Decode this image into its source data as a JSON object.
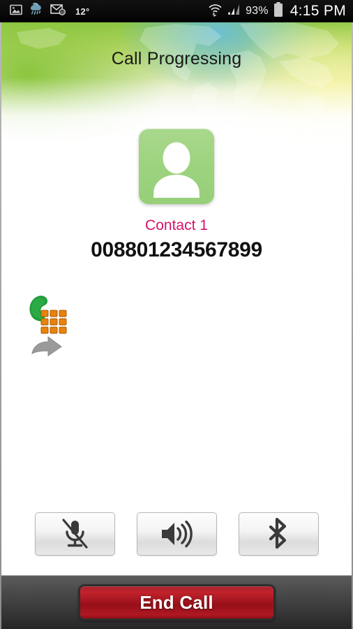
{
  "status_bar": {
    "icons_left": [
      "image-icon",
      "weather-rain-icon",
      "email-icon"
    ],
    "temperature": "12°",
    "wifi_icon": "wifi-icon",
    "signal_icon": "cellular-signal-icon",
    "battery_percent": "93%",
    "battery_icon": "battery-icon",
    "clock": "4:15 PM"
  },
  "header": {
    "call_state": "Call Progressing",
    "background_colors": {
      "green": "#8cc63f",
      "teal": "#6abed7",
      "yellow": "#f7f4a0",
      "white": "#ffffff"
    }
  },
  "contact": {
    "avatar_icon": "person-avatar-icon",
    "avatar_color": "#9dd37f",
    "name": "Contact 1",
    "name_color": "#d5136a",
    "number": "008801234567899"
  },
  "call_action": {
    "icon": "dialpad-phone-forward-icon",
    "handset_color": "#1f9d3a",
    "keypad_color": "#e8820c",
    "arrow_color": "#999999"
  },
  "controls": [
    {
      "name": "mute",
      "icon": "microphone-muted-icon"
    },
    {
      "name": "speaker",
      "icon": "speaker-on-icon"
    },
    {
      "name": "bluetooth",
      "icon": "bluetooth-icon"
    }
  ],
  "bottom": {
    "end_call_label": "End Call",
    "end_call_color": "#b01822"
  }
}
